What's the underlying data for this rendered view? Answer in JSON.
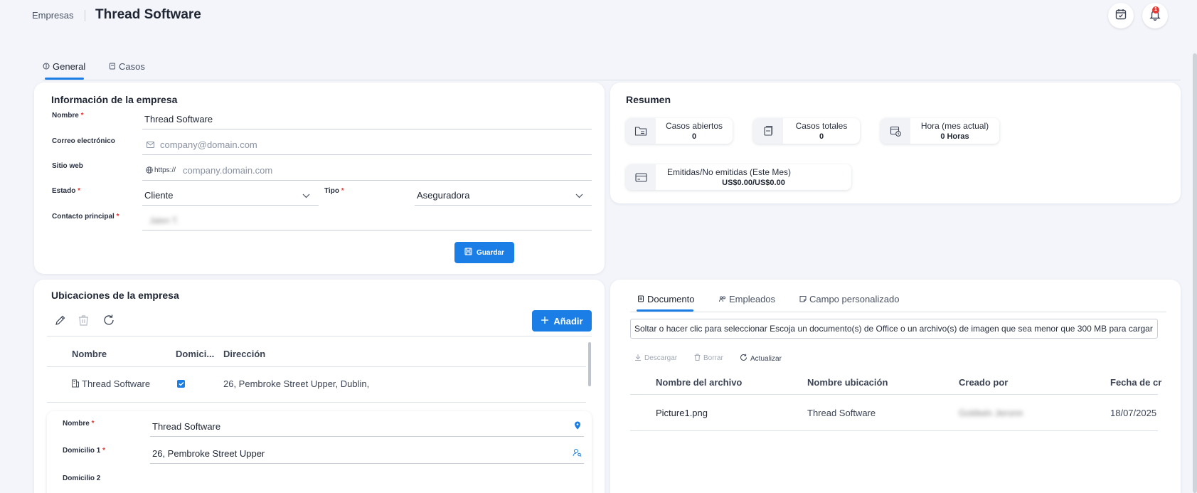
{
  "header": {
    "breadcrumb": "Empresas",
    "title": "Thread Software",
    "notification_count": "1"
  },
  "tabs": [
    {
      "label": "General",
      "active": true
    },
    {
      "label": "Casos",
      "active": false
    }
  ],
  "company_info": {
    "title": "Información de la empresa",
    "name_label": "Nombre",
    "name_value": "Thread Software",
    "email_label": "Correo electrónico",
    "email_placeholder": "company@domain.com",
    "web_label": "Sitio web",
    "web_prefix": "https://",
    "web_placeholder": "company.domain.com",
    "status_label": "Estado",
    "status_value": "Cliente",
    "type_label": "Tipo",
    "type_value": "Aseguradora",
    "contact_label": "Contacto principal",
    "contact_value": "Jalen T.",
    "save_button": "Guardar",
    "required_mark": "*"
  },
  "summary": {
    "title": "Resumen",
    "open_cases_label": "Casos abiertos",
    "open_cases_value": "0",
    "total_cases_label": "Casos totales",
    "total_cases_value": "0",
    "hours_label": "Hora (mes actual)",
    "hours_value": "0 Horas",
    "billing_label": "Emitidas/No emitidas (Este Mes)",
    "billing_value": "US$0.00/US$0.00"
  },
  "locations": {
    "title": "Ubicaciones de la empresa",
    "add_button": "Añadir",
    "col_name": "Nombre",
    "col_domicile": "Domici...",
    "col_address": "Dirección",
    "rows": [
      {
        "name": "Thread Software",
        "domicile_checked": true,
        "address": "26, Pembroke Street Upper, Dublin,"
      }
    ],
    "detail": {
      "name_label": "Nombre",
      "name_value": "Thread Software",
      "address1_label": "Domicilio 1",
      "address1_value": "26, Pembroke Street Upper",
      "address2_label": "Domicilio 2"
    }
  },
  "documents": {
    "tabs": [
      {
        "label": "Documento",
        "active": true
      },
      {
        "label": "Empleados",
        "active": false
      },
      {
        "label": "Campo personalizado",
        "active": false
      }
    ],
    "dropzone_text": "Soltar o hacer clic para seleccionar Escoja un documento(s) de Office o un archivo(s) de imagen que sea menor que 300 MB para cargar",
    "toolbar": {
      "download": "Descargar",
      "delete": "Borrar",
      "refresh": "Actualizar"
    },
    "columns": [
      "Nombre del archivo",
      "Nombre ubicación",
      "Creado por",
      "Fecha de cr"
    ],
    "rows": [
      {
        "file": "Picture1.png",
        "location": "Thread Software",
        "creator": "Goldwin Jeronn",
        "date": "18/07/2025"
      }
    ]
  }
}
